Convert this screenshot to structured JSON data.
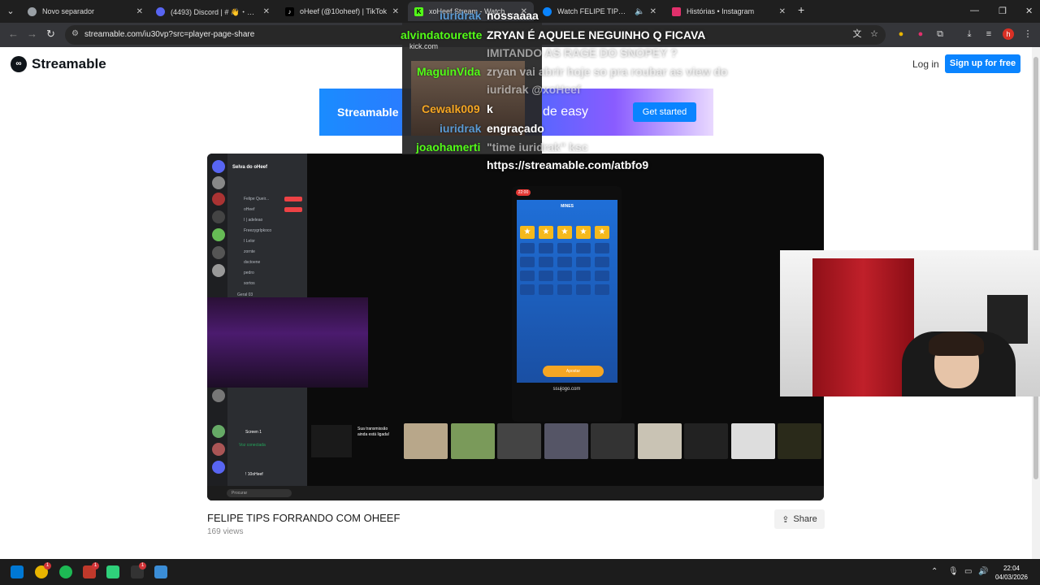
{
  "browser": {
    "tabs": [
      {
        "title": "Novo separador",
        "favicon_color": "#9aa0a6"
      },
      {
        "title": "(4493) Discord | # 👋・entra",
        "favicon_color": "#5865f2"
      },
      {
        "title": "oHeef (@10oheef) | TikTok",
        "favicon_color": "#000000"
      },
      {
        "title": "xoHeef Stream - Watch Live on",
        "favicon_color": "#53fc18"
      },
      {
        "title": "Watch FELIPE TIPS FORRAN",
        "favicon_color": "#0a84ff"
      },
      {
        "title": "Histórias • Instagram",
        "favicon_color": "#e1306c"
      }
    ],
    "new_tab": "+",
    "url": "streamable.com/iu30vp?src=player-page-share"
  },
  "site": {
    "logo_text": "Streamable",
    "login": "Log in",
    "signup": "Sign up for free"
  },
  "banner": {
    "brand": "Streamable",
    "made": "de easy",
    "cta": "Get started"
  },
  "video": {
    "title": "FELIPE TIPS FORRANDO COM OHEEF",
    "views": "169 views",
    "share": "Share",
    "discord_server": "Selva do oHeef",
    "discord_channels": [
      "Felipe Queir...",
      "oHeef",
      "I | adeleao",
      "Freezygrlpkoco",
      "I Lelor",
      "zornte",
      "dsctoene",
      "pedro",
      "sortos",
      "Geral 03"
    ],
    "discord_screen": "Screen 1",
    "discord_voice": "Voz conectada",
    "discord_user": "! 10oHeef",
    "phone_title": "MINES",
    "phone_time": "22:00",
    "phone_url": "ssujogo.com",
    "phone_button": "Apostar",
    "taskbar_search": "Procurar",
    "live_badge": "AO VIVO",
    "live_text": "Sua transmissão ainda está ligada!"
  },
  "chat": {
    "kick_url": "kick.com",
    "lines": [
      {
        "user": "iuridrak",
        "user_color": "#5b9bd5",
        "msg": "nossaaaa"
      },
      {
        "user": "alvindatourette",
        "user_color": "#53fc18",
        "msg": "ZRYAN É AQUELE NEGUINHO Q FICAVA"
      },
      {
        "user": "",
        "user_color": "",
        "msg": "IMITANDO AS RAGE DO SNOPEY ?"
      },
      {
        "user": "MaguinVida",
        "user_color": "#53fc18",
        "msg": "zryan vai abrir hoje so pra roubar as view do"
      },
      {
        "user": "",
        "user_color": "",
        "msg": "iuridrak @xoHeef"
      },
      {
        "user": "Cewalk009",
        "user_color": "#f5a623",
        "msg": "k"
      },
      {
        "user": "iuridrak",
        "user_color": "#5b9bd5",
        "msg": "engraçado"
      },
      {
        "user": "joaohamerti",
        "user_color": "#53fc18",
        "msg": "\"time iuridrak\" ksc"
      },
      {
        "user": "",
        "user_color": "",
        "msg": "https://streamable.com/atbfo9"
      }
    ]
  },
  "taskbar": {
    "time": "22:04",
    "date": "04/03/2026",
    "badges": [
      "1",
      "1",
      "1"
    ]
  }
}
